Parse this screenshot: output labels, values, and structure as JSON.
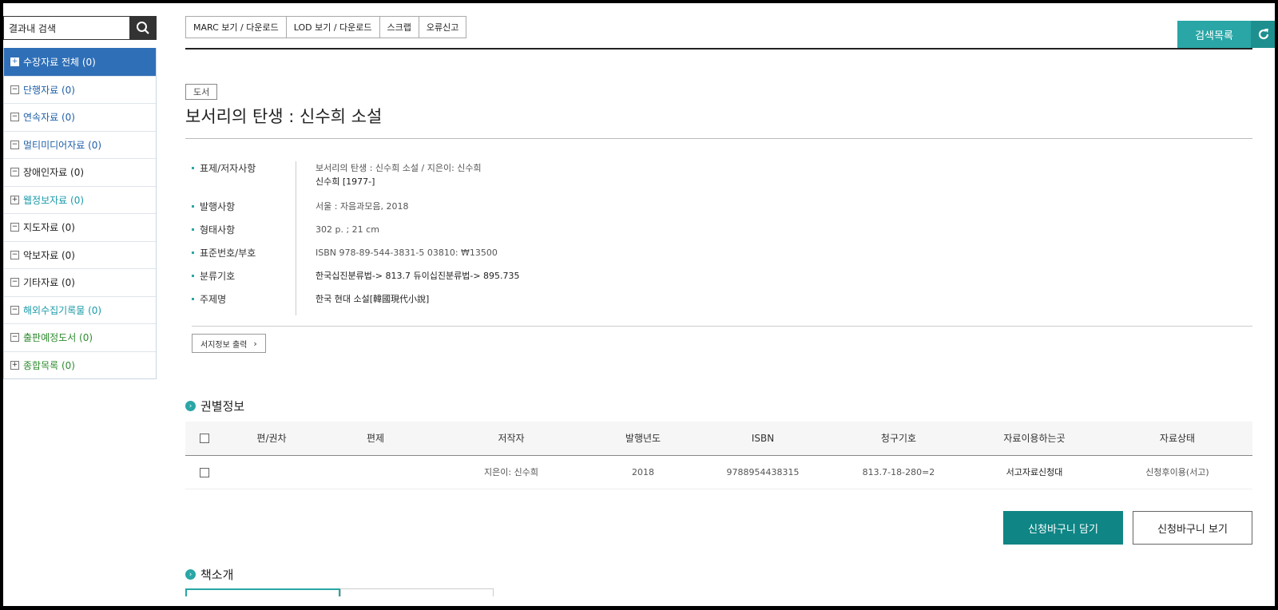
{
  "search": {
    "value": "결과내 검색"
  },
  "sidebar": {
    "items": [
      {
        "label": "수장자료 전체 (0)",
        "sign": "+",
        "color": "#ffffff"
      },
      {
        "label": "단행자료 (0)",
        "sign": "−",
        "color": "#1f5fa8"
      },
      {
        "label": "연속자료 (0)",
        "sign": "−",
        "color": "#1f5fa8"
      },
      {
        "label": "멀티미디어자료 (0)",
        "sign": "−",
        "color": "#1f5fa8"
      },
      {
        "label": "장애인자료 (0)",
        "sign": "−",
        "color": "#222222"
      },
      {
        "label": "웹정보자료 (0)",
        "sign": "+",
        "color": "#1a9aa8"
      },
      {
        "label": "지도자료 (0)",
        "sign": "−",
        "color": "#222222"
      },
      {
        "label": "악보자료 (0)",
        "sign": "−",
        "color": "#222222"
      },
      {
        "label": "기타자료 (0)",
        "sign": "−",
        "color": "#222222"
      },
      {
        "label": "해외수집기록물 (0)",
        "sign": "−",
        "color": "#1a9aa8"
      },
      {
        "label": "출판예정도서 (0)",
        "sign": "−",
        "color": "#2e8b2e"
      },
      {
        "label": "종합목록 (0)",
        "sign": "+",
        "color": "#2e8b2e"
      }
    ]
  },
  "toolbar": {
    "marc": "MARC 보기 / 다운로드",
    "lod": "LOD 보기 / 다운로드",
    "scrap": "스크랩",
    "report": "오류신고"
  },
  "back_list": "검색목록",
  "record": {
    "type": "도서",
    "title": "보서리의 탄생 : 신수희 소설",
    "fields": [
      {
        "key": "표제/저자사항",
        "lines": [
          "보서리의 탄생 : 신수희 소설 / 지은이: 신수희",
          "신수희 [1977-]"
        ]
      },
      {
        "key": "발행사항",
        "lines": [
          "서울 : 자음과모음, 2018"
        ]
      },
      {
        "key": "형태사항",
        "lines": [
          "302 p. ; 21 cm"
        ]
      },
      {
        "key": "표준번호/부호",
        "lines": [
          "ISBN 978-89-544-3831-5 03810: ₩13500"
        ]
      },
      {
        "key": "분류기호",
        "lines": [
          "한국십진분류법-> 813.7  듀이십진분류법-> 895.735"
        ]
      },
      {
        "key": "주제명",
        "lines": [
          "한국 현대 소설[韓國現代小說]"
        ]
      }
    ],
    "print_label": "서지정보 출력"
  },
  "volumes": {
    "heading": "권별정보",
    "headers": [
      "편/권차",
      "편제",
      "저작자",
      "발행년도",
      "ISBN",
      "청구기호",
      "자료이용하는곳",
      "자료상태"
    ],
    "rows": [
      [
        "",
        "",
        "지은이: 신수희",
        "2018",
        "9788954438315",
        "813.7-18-280=2",
        "서고자료신청대",
        "신청후이용(서고)"
      ]
    ]
  },
  "buttons": {
    "add_cart": "신청바구니 담기",
    "view_cart": "신청바구니 보기"
  },
  "intro": {
    "heading": "책소개"
  },
  "colors": {
    "accent": "#2aa6a6",
    "accent_dark": "#0f8585",
    "active_nav": "#2f6fb7"
  }
}
